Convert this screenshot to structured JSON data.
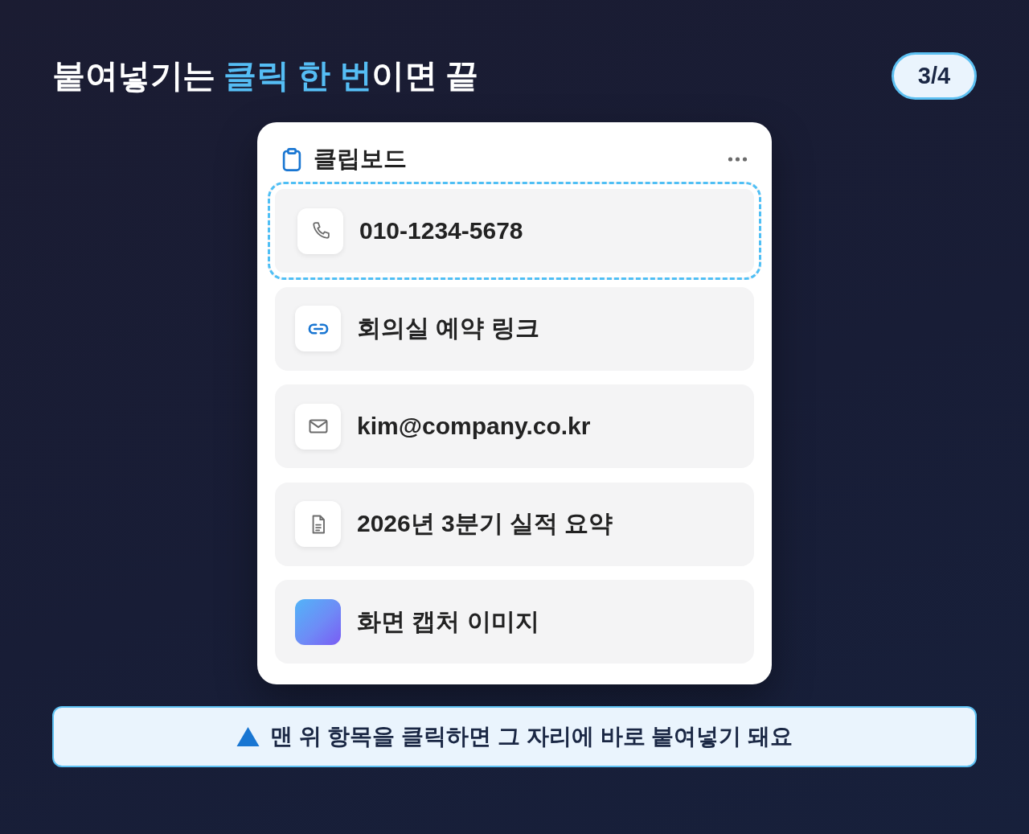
{
  "header": {
    "title": "붙여넣기는 **클릭 한 번**이면 끝",
    "page_indicator": "3/4"
  },
  "clipboard": {
    "title": "클립보드",
    "items": [
      {
        "kind": "phone",
        "text": "010-1234-5678",
        "selected": true
      },
      {
        "kind": "link",
        "text": "회의실 예약 링크",
        "selected": false
      },
      {
        "kind": "email",
        "text": "kim@company.co.kr",
        "selected": false
      },
      {
        "kind": "document",
        "text": "2026년 3분기 실적 요약",
        "selected": false
      },
      {
        "kind": "image",
        "text": "화면 캡처 이미지",
        "selected": false
      }
    ]
  },
  "hint": {
    "text": "맨 위 항목을 클릭하면 그 자리에 바로 붙여넣기 돼요"
  }
}
